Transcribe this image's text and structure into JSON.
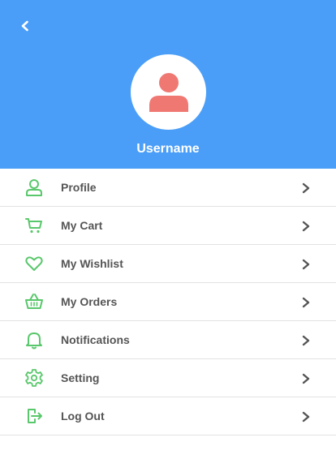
{
  "colors": {
    "header_bg": "#4a9ef8",
    "accent_icon": "#59c76b",
    "avatar_person": "#f07873",
    "label_text": "#555555",
    "chevron": "#555555"
  },
  "header": {
    "back_icon": "chevron-left-icon",
    "avatar_icon": "person-icon",
    "username": "Username"
  },
  "menu": {
    "items": [
      {
        "label": "Profile",
        "icon": "user-icon"
      },
      {
        "label": "My Cart",
        "icon": "cart-icon"
      },
      {
        "label": "My Wishlist",
        "icon": "heart-icon"
      },
      {
        "label": "My Orders",
        "icon": "basket-icon"
      },
      {
        "label": "Notifications",
        "icon": "bell-icon"
      },
      {
        "label": "Setting",
        "icon": "gear-icon"
      },
      {
        "label": "Log Out",
        "icon": "logout-icon"
      }
    ],
    "trailing_icon": "chevron-right-icon"
  }
}
